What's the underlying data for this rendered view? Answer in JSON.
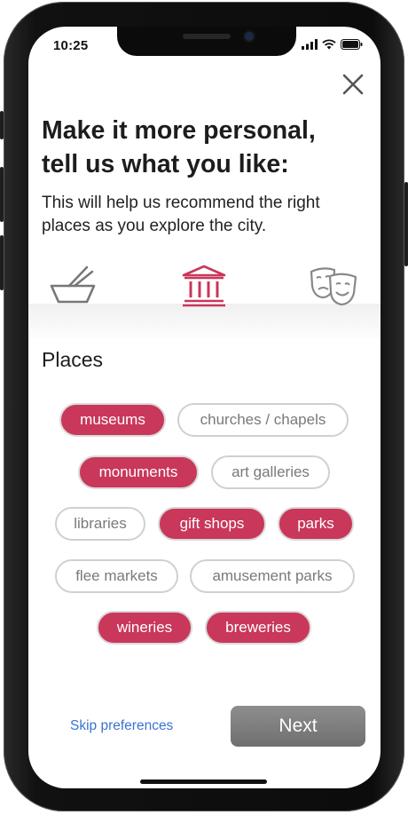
{
  "status_bar": {
    "time": "10:25"
  },
  "onboarding": {
    "title_line1": "Make it more personal,",
    "title_line2": "tell us what you like:",
    "subtitle_line1": "This will help us recommend the right",
    "subtitle_line2": "places as you explore the city."
  },
  "categories": [
    {
      "icon": "food-bowl-icon",
      "selected": false
    },
    {
      "icon": "museum-icon",
      "selected": true
    },
    {
      "icon": "theater-masks-icon",
      "selected": false
    }
  ],
  "section": {
    "title": "Places"
  },
  "chips": [
    {
      "label": "museums",
      "selected": true
    },
    {
      "label": "churches / chapels",
      "selected": false
    },
    {
      "label": "monuments",
      "selected": true
    },
    {
      "label": "art galleries",
      "selected": false
    },
    {
      "label": "libraries",
      "selected": false
    },
    {
      "label": "gift shops",
      "selected": true
    },
    {
      "label": "parks",
      "selected": true
    },
    {
      "label": "flee markets",
      "selected": false
    },
    {
      "label": "amusement parks",
      "selected": false
    },
    {
      "label": "wineries",
      "selected": true
    },
    {
      "label": "breweries",
      "selected": true
    }
  ],
  "footer": {
    "skip_label": "Skip preferences",
    "next_label": "Next"
  },
  "colors": {
    "accent": "#c9375a",
    "link": "#3b73d1",
    "next_button": "#7d7d7d"
  }
}
